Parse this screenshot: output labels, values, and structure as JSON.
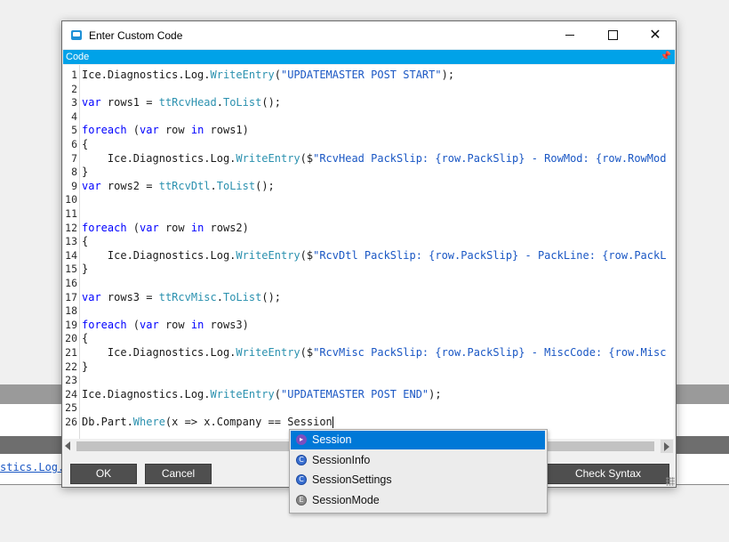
{
  "dialog": {
    "title": "Enter Custom Code",
    "section_label": "Code",
    "pin_icon": "pin-icon"
  },
  "background": {
    "code_fragment": "stics.Log.Wri"
  },
  "editor": {
    "lines": [
      {
        "n": "1",
        "html": "Ice.Diagnostics.Log.<span class=\"m\">WriteEntry</span>(<span class=\"str\">\"UPDATEMASTER POST START\"</span>);"
      },
      {
        "n": "2",
        "html": ""
      },
      {
        "n": "3",
        "html": "<span class=\"kw\">var</span> rows1 = <span class=\"m\">ttRcvHead</span>.<span class=\"m\">ToList</span>();"
      },
      {
        "n": "4",
        "html": ""
      },
      {
        "n": "5",
        "html": "<span class=\"kw\">foreach</span> (<span class=\"kw\">var</span> row <span class=\"kw\">in</span> rows1)"
      },
      {
        "n": "6",
        "html": "{"
      },
      {
        "n": "7",
        "html": "    Ice.Diagnostics.Log.<span class=\"m\">WriteEntry</span>($<span class=\"str\">\"RcvHead PackSlip: {row.PackSlip} - RowMod: {row.RowMod</span>"
      },
      {
        "n": "8",
        "html": "}"
      },
      {
        "n": "9",
        "html": "<span class=\"kw\">var</span> rows2 = <span class=\"m\">ttRcvDtl</span>.<span class=\"m\">ToList</span>();"
      },
      {
        "n": "10",
        "html": ""
      },
      {
        "n": "11",
        "html": ""
      },
      {
        "n": "12",
        "html": "<span class=\"kw\">foreach</span> (<span class=\"kw\">var</span> row <span class=\"kw\">in</span> rows2)"
      },
      {
        "n": "13",
        "html": "{"
      },
      {
        "n": "14",
        "html": "    Ice.Diagnostics.Log.<span class=\"m\">WriteEntry</span>($<span class=\"str\">\"RcvDtl PackSlip: {row.PackSlip} - PackLine: {row.PackL</span>"
      },
      {
        "n": "15",
        "html": "}"
      },
      {
        "n": "16",
        "html": ""
      },
      {
        "n": "17",
        "html": "<span class=\"kw\">var</span> rows3 = <span class=\"m\">ttRcvMisc</span>.<span class=\"m\">ToList</span>();"
      },
      {
        "n": "18",
        "html": ""
      },
      {
        "n": "19",
        "html": "<span class=\"kw\">foreach</span> (<span class=\"kw\">var</span> row <span class=\"kw\">in</span> rows3)"
      },
      {
        "n": "20",
        "html": "{"
      },
      {
        "n": "21",
        "html": "    Ice.Diagnostics.Log.<span class=\"m\">WriteEntry</span>($<span class=\"str\">\"RcvMisc PackSlip: {row.PackSlip} - MiscCode: {row.Misc</span>"
      },
      {
        "n": "22",
        "html": "}"
      },
      {
        "n": "23",
        "html": ""
      },
      {
        "n": "24",
        "html": "Ice.Diagnostics.Log.<span class=\"m\">WriteEntry</span>(<span class=\"str\">\"UPDATEMASTER POST END\"</span>);"
      },
      {
        "n": "25",
        "html": ""
      },
      {
        "n": "26",
        "html": "Db.Part.<span class=\"m\">Where</span>(x =&gt; x.Company == Session<span class=\"caret\"></span>"
      }
    ]
  },
  "buttons": {
    "ok": "OK",
    "cancel": "Cancel",
    "check_syntax": "Check Syntax"
  },
  "autocomplete": {
    "items": [
      {
        "label": "Session",
        "kind": "property",
        "selected": true
      },
      {
        "label": "SessionInfo",
        "kind": "class",
        "selected": false
      },
      {
        "label": "SessionSettings",
        "kind": "class",
        "selected": false
      },
      {
        "label": "SessionMode",
        "kind": "enum",
        "selected": false
      }
    ]
  },
  "colors": {
    "accent": "#00a2e8",
    "selection": "#0078d7",
    "button": "#4f4f4f"
  }
}
